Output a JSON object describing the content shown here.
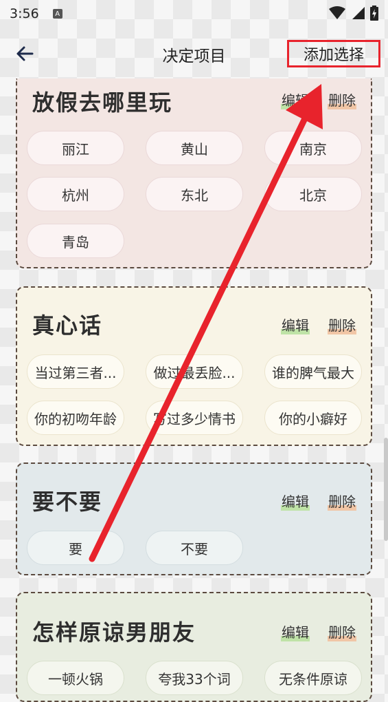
{
  "status": {
    "time": "3:56",
    "notification_icon": "A"
  },
  "header": {
    "title": "决定项目",
    "add_label": "添加选择"
  },
  "cards": [
    {
      "title": "放假去哪里玩",
      "edit_label": "编辑",
      "delete_label": "删除",
      "options": [
        "丽江",
        "黄山",
        "南京",
        "杭州",
        "东北",
        "北京",
        "青岛"
      ],
      "background": "#f3e6e3"
    },
    {
      "title": "真心话",
      "edit_label": "编辑",
      "delete_label": "删除",
      "options": [
        "当过第三者...",
        "做过最丢脸...",
        "谁的脾气最大",
        "你的初吻年龄",
        "写过多少情书",
        "你的小癖好"
      ],
      "background": "#f8f4e6"
    },
    {
      "title": "要不要",
      "edit_label": "编辑",
      "delete_label": "删除",
      "options": [
        "要",
        "不要"
      ],
      "background": "#e2e9eb"
    },
    {
      "title": "怎样原谅男朋友",
      "edit_label": "编辑",
      "delete_label": "删除",
      "options": [
        "一顿火锅",
        "夸我33个词",
        "无条件原谅"
      ],
      "background": "#e8ede0"
    }
  ],
  "colors": {
    "annotation_red": "#e8232c",
    "edit_underline": "#bfe3a7",
    "delete_underline": "#f1c6a6"
  }
}
